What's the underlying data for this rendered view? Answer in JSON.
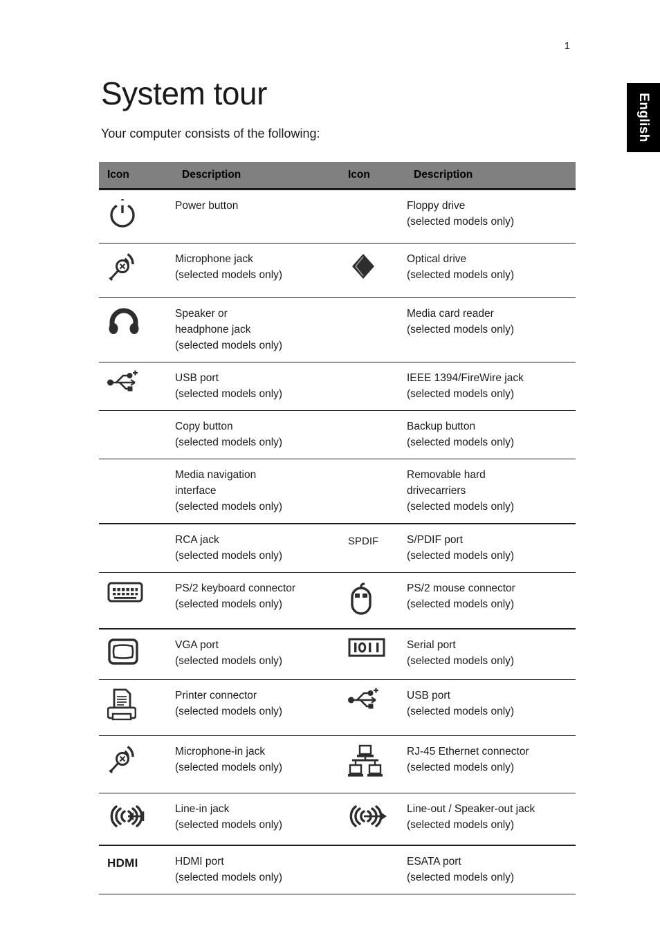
{
  "page": {
    "number": "1",
    "language_tab": "English",
    "title": "System tour",
    "intro": "Your computer consists of the following:"
  },
  "table": {
    "headers": [
      "Icon",
      "Description",
      "Icon",
      "Description"
    ],
    "header_bg": "#808080",
    "sub_note": "(selected models only)",
    "rows": [
      {
        "left": {
          "icon": "power-button-icon",
          "name": "Power button",
          "note": ""
        },
        "right": {
          "icon": "",
          "name": "Floppy drive",
          "note": "(selected models only)"
        }
      },
      {
        "left": {
          "icon": "microphone-jack-icon",
          "name": "Microphone jack",
          "note": "(selected models only)"
        },
        "right": {
          "icon": "optical-drive-icon",
          "name": "Optical drive",
          "note": "(selected models only)"
        }
      },
      {
        "left": {
          "icon": "headphone-icon",
          "name": "Speaker or\nheadphone jack",
          "note": "(selected models only)"
        },
        "right": {
          "icon": "",
          "name": "Media card reader",
          "note": "(selected models only)"
        }
      },
      {
        "left": {
          "icon": "usb-port-icon",
          "name": "USB port",
          "note": "(selected models only)"
        },
        "right": {
          "icon": "",
          "name": "IEEE 1394/FireWire jack",
          "note": "(selected models only)"
        }
      },
      {
        "left": {
          "icon": "",
          "name": "Copy button",
          "note": "(selected models only)"
        },
        "right": {
          "icon": "",
          "name": "Backup button",
          "note": "(selected models only)"
        }
      },
      {
        "left": {
          "icon": "",
          "name": "Media navigation\ninterface",
          "note": "(selected models only)"
        },
        "right": {
          "icon": "",
          "name": "Removable hard\ndrivecarriers",
          "note": "(selected models only)"
        }
      },
      {
        "left": {
          "icon": "",
          "name": "RCA jack",
          "note": "(selected models only)"
        },
        "right": {
          "icon": "spdif-text-icon",
          "icon_text": "SPDIF",
          "name": "S/PDIF port",
          "note": "(selected models only)"
        }
      },
      {
        "left": {
          "icon": "ps2-keyboard-icon",
          "name": "PS/2 keyboard connector",
          "note": "(selected models only)"
        },
        "right": {
          "icon": "ps2-mouse-icon",
          "name": "PS/2 mouse connector",
          "note": "(selected models only)"
        }
      },
      {
        "left": {
          "icon": "vga-port-icon",
          "name": "VGA port",
          "note": "(selected models only)"
        },
        "right": {
          "icon": "serial-port-icon",
          "name": "Serial port",
          "note": "(selected models only)"
        }
      },
      {
        "left": {
          "icon": "printer-connector-icon",
          "name": "Printer connector",
          "note": "(selected models only)"
        },
        "right": {
          "icon": "usb-port-icon",
          "name": "USB port",
          "note": "(selected models only)"
        }
      },
      {
        "left": {
          "icon": "microphone-in-icon",
          "name": "Microphone-in jack",
          "note": "(selected models only)"
        },
        "right": {
          "icon": "rj45-ethernet-icon",
          "name": "RJ-45 Ethernet connector",
          "note": "(selected models only)"
        }
      },
      {
        "left": {
          "icon": "line-in-icon",
          "name": "Line-in jack",
          "note": "(selected models only)"
        },
        "right": {
          "icon": "line-out-icon",
          "name": "Line-out / Speaker-out jack",
          "note": "(selected models only)"
        }
      },
      {
        "left": {
          "icon": "hdmi-text-icon",
          "icon_text": "HDMI",
          "name": "HDMI port",
          "note": "(selected models only)"
        },
        "right": {
          "icon": "",
          "name": "ESATA port",
          "note": "(selected models only)"
        }
      }
    ]
  }
}
